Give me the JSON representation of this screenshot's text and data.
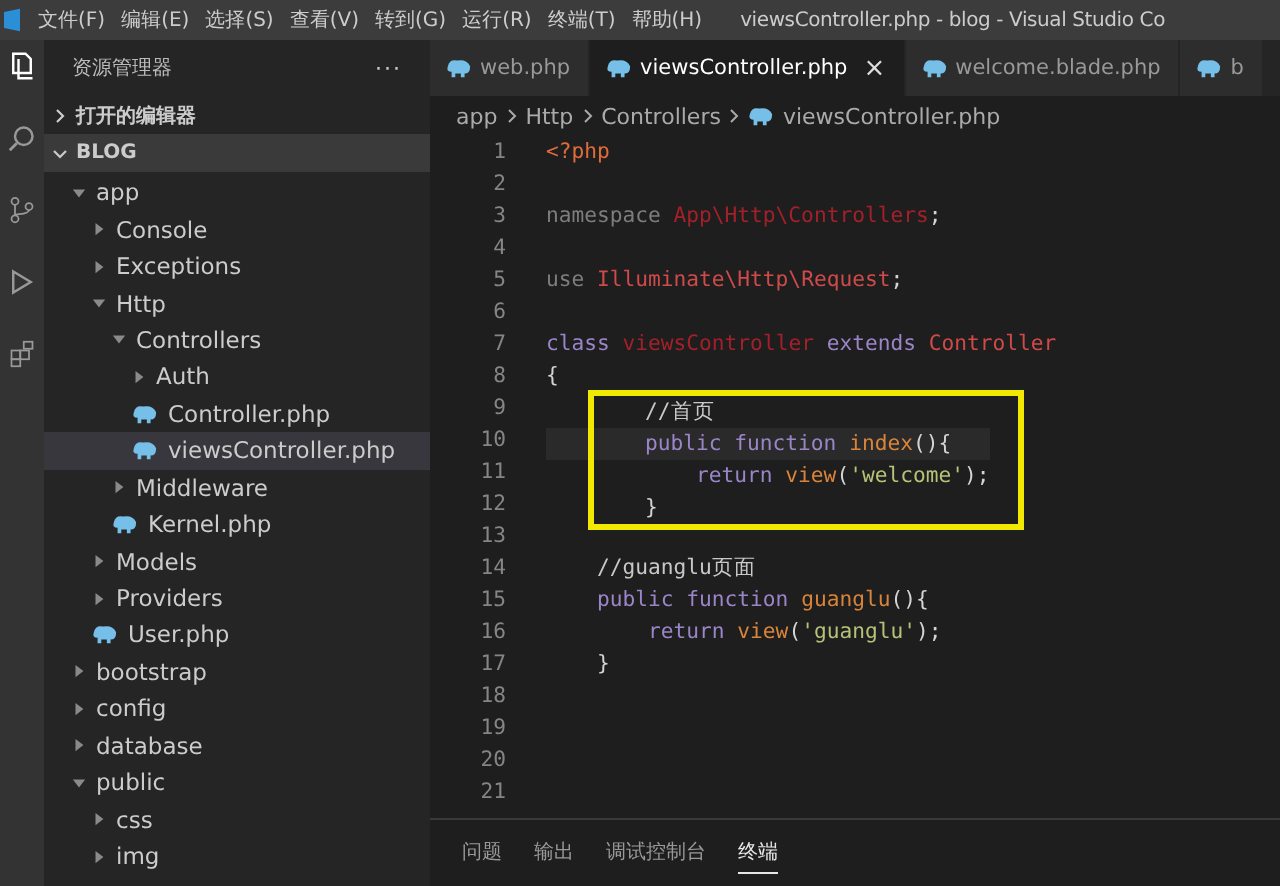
{
  "menu": [
    "文件(F)",
    "编辑(E)",
    "选择(S)",
    "查看(V)",
    "转到(G)",
    "运行(R)",
    "终端(T)",
    "帮助(H)"
  ],
  "window": {
    "title": "viewsController.php - blog - Visual Studio Co"
  },
  "sidebar": {
    "title": "资源管理器",
    "more": "···",
    "sections": [
      {
        "label": "打开的编辑器",
        "expanded": false
      },
      {
        "label": "BLOG",
        "expanded": true
      }
    ],
    "tree": [
      {
        "label": "app",
        "kind": "folder",
        "expanded": true,
        "selected": false,
        "children": [
          {
            "label": "Console",
            "kind": "folder",
            "expanded": false,
            "selected": false
          },
          {
            "label": "Exceptions",
            "kind": "folder",
            "expanded": false,
            "selected": false
          },
          {
            "label": "Http",
            "kind": "folder",
            "expanded": true,
            "selected": false,
            "children": [
              {
                "label": "Controllers",
                "kind": "folder",
                "expanded": true,
                "selected": false,
                "children": [
                  {
                    "label": "Auth",
                    "kind": "folder",
                    "expanded": false,
                    "selected": false
                  },
                  {
                    "label": "Controller.php",
                    "kind": "file",
                    "selected": false
                  },
                  {
                    "label": "viewsController.php",
                    "kind": "file",
                    "selected": true
                  }
                ]
              },
              {
                "label": "Middleware",
                "kind": "folder",
                "expanded": false,
                "selected": false
              },
              {
                "label": "Kernel.php",
                "kind": "file",
                "selected": false
              }
            ]
          },
          {
            "label": "Models",
            "kind": "folder",
            "expanded": false,
            "selected": false
          },
          {
            "label": "Providers",
            "kind": "folder",
            "expanded": false,
            "selected": false
          },
          {
            "label": "User.php",
            "kind": "file",
            "selected": false
          }
        ]
      },
      {
        "label": "bootstrap",
        "kind": "folder",
        "expanded": false,
        "selected": false
      },
      {
        "label": "config",
        "kind": "folder",
        "expanded": false,
        "selected": false
      },
      {
        "label": "database",
        "kind": "folder",
        "expanded": false,
        "selected": false
      },
      {
        "label": "public",
        "kind": "folder",
        "expanded": true,
        "selected": false,
        "children": [
          {
            "label": "css",
            "kind": "folder",
            "expanded": false,
            "selected": false
          },
          {
            "label": "img",
            "kind": "folder",
            "expanded": false,
            "selected": false
          }
        ]
      }
    ]
  },
  "tabs": [
    {
      "label": "web.php",
      "selected": false
    },
    {
      "label": "viewsController.php",
      "selected": true,
      "close": "×"
    },
    {
      "label": "welcome.blade.php",
      "selected": false
    },
    {
      "label": "b",
      "selected": false
    }
  ],
  "breadcrumb": [
    "app",
    "Http",
    "Controllers",
    "viewsController.php"
  ],
  "code": [
    {
      "number": "1",
      "current": false,
      "highlighted": false,
      "tokens": [
        {
          "text": "<?php",
          "kind": "tag"
        }
      ]
    },
    {
      "number": "2",
      "current": false,
      "highlighted": false
    },
    {
      "number": "3",
      "current": false,
      "highlighted": false,
      "tokens": [
        {
          "text": "namespace ",
          "kind": "dim"
        },
        {
          "text": "App\\Http\\Controllers",
          "kind": "ns"
        },
        {
          "text": ";",
          "kind": "plain"
        }
      ]
    },
    {
      "number": "4",
      "current": false,
      "highlighted": false
    },
    {
      "number": "5",
      "current": false,
      "highlighted": false,
      "tokens": [
        {
          "text": "use ",
          "kind": "dim"
        },
        {
          "text": "Illuminate\\Http\\Request",
          "kind": "type"
        },
        {
          "text": ";",
          "kind": "plain"
        }
      ]
    },
    {
      "number": "6",
      "current": false,
      "highlighted": false
    },
    {
      "number": "7",
      "current": false,
      "highlighted": false,
      "tokens": [
        {
          "text": "class ",
          "kind": "kw"
        },
        {
          "text": "viewsController",
          "kind": "ns"
        },
        {
          "text": " extends ",
          "kind": "kw"
        },
        {
          "text": "Controller",
          "kind": "type"
        }
      ]
    },
    {
      "number": "8",
      "current": false,
      "highlighted": false,
      "tokens": [
        {
          "text": "{",
          "kind": "plain"
        }
      ]
    },
    {
      "number": "9",
      "current": false,
      "highlighted": true,
      "tokens": [
        {
          "text": "    //首页",
          "kind": "comment"
        }
      ]
    },
    {
      "number": "10",
      "current": true,
      "highlighted": true,
      "tokens": [
        {
          "text": "    public function ",
          "kind": "kw"
        },
        {
          "text": "index",
          "kind": "fn"
        },
        {
          "text": "(){",
          "kind": "plain"
        }
      ]
    },
    {
      "number": "11",
      "current": false,
      "highlighted": true,
      "tokens": [
        {
          "text": "        return ",
          "kind": "kw"
        },
        {
          "text": "view",
          "kind": "fn"
        },
        {
          "text": "(",
          "kind": "plain"
        },
        {
          "text": "'welcome'",
          "kind": "str"
        },
        {
          "text": ");",
          "kind": "plain"
        }
      ]
    },
    {
      "number": "12",
      "current": false,
      "highlighted": true,
      "tokens": [
        {
          "text": "    }",
          "kind": "plain"
        }
      ]
    },
    {
      "number": "13",
      "current": false,
      "highlighted": false
    },
    {
      "number": "14",
      "current": false,
      "highlighted": false,
      "tokens": [
        {
          "text": "    //guanglu页面",
          "kind": "comment"
        }
      ]
    },
    {
      "number": "15",
      "current": false,
      "highlighted": false,
      "tokens": [
        {
          "text": "    public function ",
          "kind": "kw"
        },
        {
          "text": "guanglu",
          "kind": "fn"
        },
        {
          "text": "(){",
          "kind": "plain"
        }
      ]
    },
    {
      "number": "16",
      "current": false,
      "highlighted": false,
      "tokens": [
        {
          "text": "        return ",
          "kind": "kw"
        },
        {
          "text": "view",
          "kind": "fn"
        },
        {
          "text": "(",
          "kind": "plain"
        },
        {
          "text": "'guanglu'",
          "kind": "str"
        },
        {
          "text": ");",
          "kind": "plain"
        }
      ]
    },
    {
      "number": "17",
      "current": false,
      "highlighted": false,
      "tokens": [
        {
          "text": "    }",
          "kind": "plain"
        }
      ]
    },
    {
      "number": "18",
      "current": false,
      "highlighted": false
    },
    {
      "number": "19",
      "current": false,
      "highlighted": false
    },
    {
      "number": "20",
      "current": false,
      "highlighted": false
    },
    {
      "number": "21",
      "current": false,
      "highlighted": false
    }
  ],
  "panel_tabs": [
    {
      "label": "问题",
      "selected": false
    },
    {
      "label": "输出",
      "selected": false
    },
    {
      "label": "调试控制台",
      "selected": false
    },
    {
      "label": "终端",
      "selected": true
    }
  ]
}
